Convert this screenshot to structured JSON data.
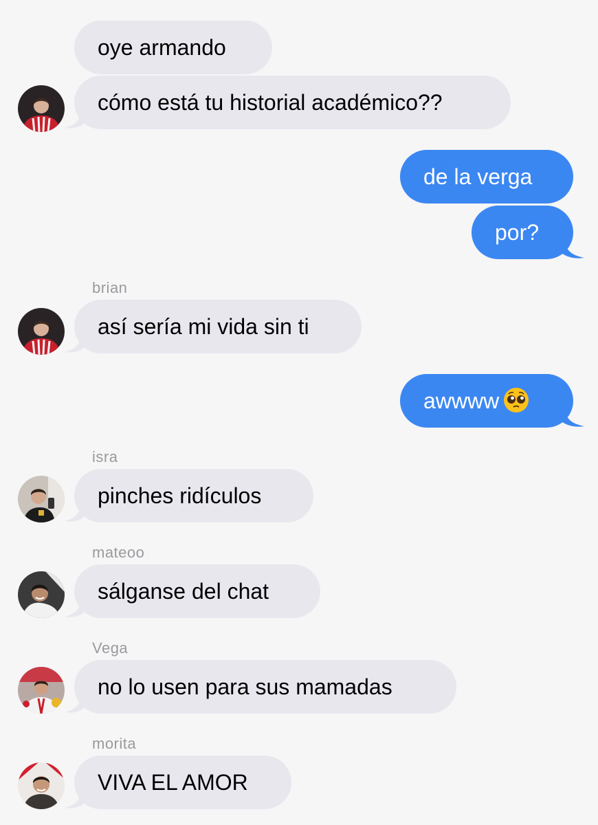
{
  "messages": [
    {
      "text": "oye armando"
    },
    {
      "text": "cómo está tu historial académico??"
    },
    {
      "text": "de la verga"
    },
    {
      "text": "por?"
    },
    {
      "sender": "brian",
      "text": "así sería mi vida sin ti"
    },
    {
      "text": "awwww",
      "emoji": "pleading-face-emoji"
    },
    {
      "sender": "isra",
      "text": "pinches ridículos"
    },
    {
      "sender": "mateoo",
      "text": "sálganse del chat"
    },
    {
      "sender": "Vega",
      "text": "no lo usen para sus mamadas"
    },
    {
      "sender": "morita",
      "text": "VIVA EL AMOR"
    }
  ],
  "colors": {
    "background": "#f6f6f6",
    "received_bubble": "#e8e7ee",
    "sent_bubble": "#3b87f2",
    "sender_name": "#9a9a9f"
  }
}
